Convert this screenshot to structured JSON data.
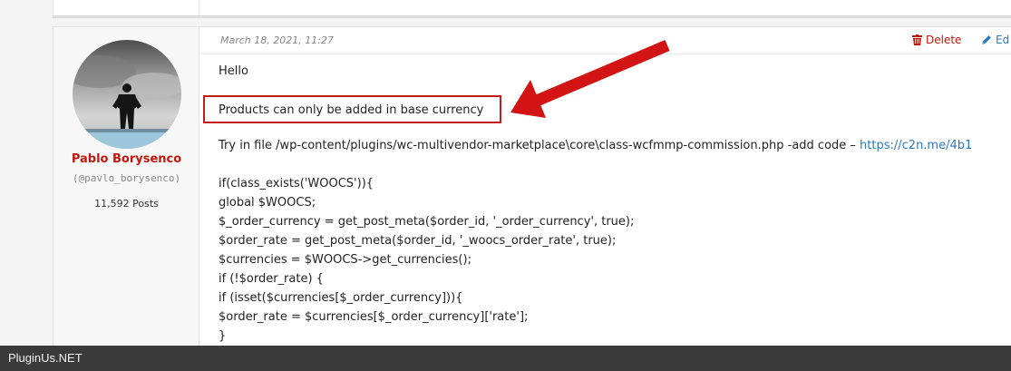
{
  "post": {
    "date": "March 18, 2021, 11:27",
    "actions": {
      "delete_label": "Delete",
      "edit_label": "Ed"
    },
    "author": {
      "name": "Pablo Borysenco",
      "handle": "(@pavlo_borysenco)",
      "posts": "11,592 Posts"
    },
    "greeting": "Hello",
    "highlight": "Products can only be added in base currency",
    "instruction_prefix": "Try  in  file  /wp-content/plugins/wc-multivendor-marketplace\\core\\class-wcfmmp-commission.php  -add  code – ",
    "instruction_link": "https://c2n.me/4b1",
    "code_lines": [
      "if(class_exists('WOOCS')){",
      "global $WOOCS;",
      "$_order_currency = get_post_meta($order_id, '_order_currency', true);",
      "$order_rate = get_post_meta($order_id, '_woocs_order_rate', true);",
      "$currencies = $WOOCS->get_currencies();",
      "if (!$order_rate) {",
      "if (isset($currencies[$_order_currency])){",
      "$order_rate = $currencies[$_order_currency]['rate'];",
      "}"
    ]
  },
  "footer": {
    "brand": "PluginUs.NET"
  },
  "colors": {
    "accent_red": "#c0190e",
    "link_blue": "#2a77c9",
    "annotation_red": "#d21414"
  },
  "icons": {
    "delete": "trash-icon",
    "edit": "pencil-icon"
  }
}
